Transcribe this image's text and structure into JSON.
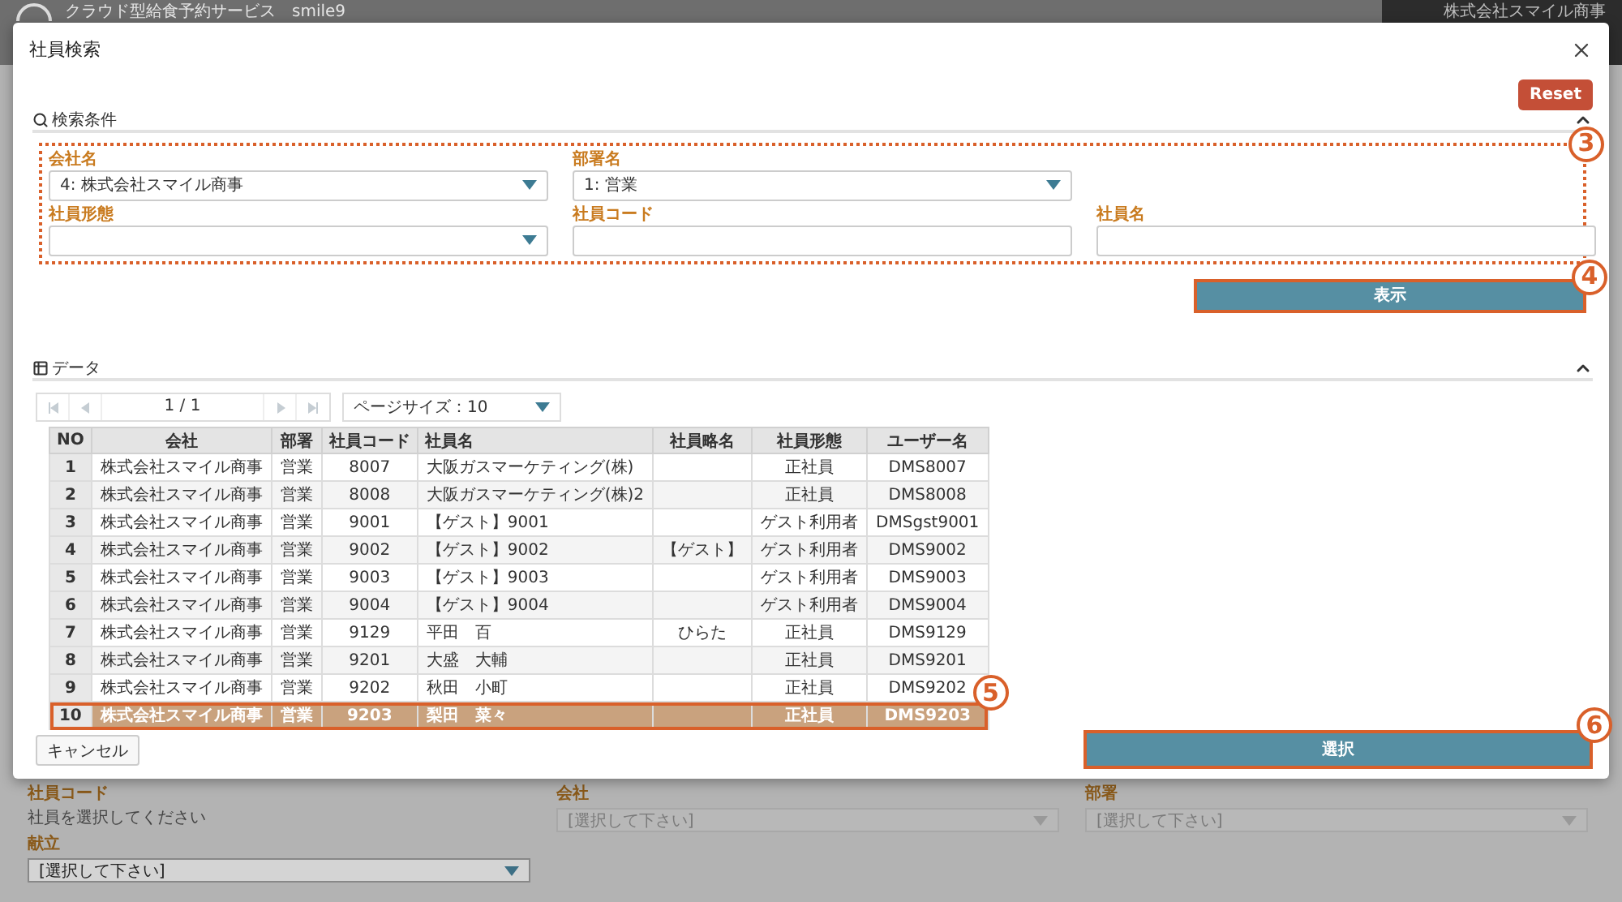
{
  "background": {
    "header_title": "クラウド型給食予約サービス　smile9",
    "header_user": "株式会社スマイル商事",
    "fields": [
      {
        "label": "社員コード",
        "kind": "text",
        "value": "社員を選択してください"
      },
      {
        "label": "会社",
        "kind": "select",
        "value": "[選択して下さい]",
        "disabled": true
      },
      {
        "label": "部署",
        "kind": "select",
        "value": "[選択して下さい]",
        "disabled": true
      },
      {
        "label": "献立",
        "kind": "select",
        "value": "[選択して下さい]",
        "disabled": false
      }
    ]
  },
  "dialog": {
    "title": "社員検索",
    "reset_button": "Reset",
    "search_section": {
      "title": "検索条件",
      "expanded": true,
      "callout": "3",
      "rows": [
        [
          {
            "label": "会社名",
            "kind": "select",
            "value": "4: 株式会社スマイル商事"
          },
          {
            "label": "部署名",
            "kind": "select",
            "value": "1: 営業"
          }
        ],
        [
          {
            "label": "社員形態",
            "kind": "select"
          },
          {
            "label": "社員コード",
            "kind": "text"
          },
          {
            "label": "社員名",
            "kind": "text"
          }
        ]
      ],
      "show_button": {
        "label": "表示",
        "callout": "4"
      }
    },
    "data_section": {
      "title": "データ",
      "expanded": true,
      "pager": {
        "page": "1 / 1",
        "page_size": "ページサイズ：10"
      },
      "table": {
        "callout": "5",
        "columns": [
          "NO",
          "会社",
          "部署",
          "社員コード",
          "社員名",
          "社員略名",
          "社員形態",
          "ユーザー名"
        ],
        "rows": [
          {
            "cells": [
              "1",
              "株式会社スマイル商事",
              "営業",
              "8007",
              "大阪ガスマーケティング(株)",
              "",
              "正社員",
              "DMS8007"
            ],
            "selected": false
          },
          {
            "cells": [
              "2",
              "株式会社スマイル商事",
              "営業",
              "8008",
              "大阪ガスマーケティング(株)2",
              "",
              "正社員",
              "DMS8008"
            ],
            "selected": false
          },
          {
            "cells": [
              "3",
              "株式会社スマイル商事",
              "営業",
              "9001",
              "【ゲスト】9001",
              "",
              "ゲスト利用者",
              "DMSgst9001"
            ],
            "selected": false
          },
          {
            "cells": [
              "4",
              "株式会社スマイル商事",
              "営業",
              "9002",
              "【ゲスト】9002",
              "【ゲスト】",
              "ゲスト利用者",
              "DMS9002"
            ],
            "selected": false
          },
          {
            "cells": [
              "5",
              "株式会社スマイル商事",
              "営業",
              "9003",
              "【ゲスト】9003",
              "",
              "ゲスト利用者",
              "DMS9003"
            ],
            "selected": false
          },
          {
            "cells": [
              "6",
              "株式会社スマイル商事",
              "営業",
              "9004",
              "【ゲスト】9004",
              "",
              "ゲスト利用者",
              "DMS9004"
            ],
            "selected": false
          },
          {
            "cells": [
              "7",
              "株式会社スマイル商事",
              "営業",
              "9129",
              "平田　百",
              "ひらた",
              "正社員",
              "DMS9129"
            ],
            "selected": false
          },
          {
            "cells": [
              "8",
              "株式会社スマイル商事",
              "営業",
              "9201",
              "大盛　大輔",
              "",
              "正社員",
              "DMS9201"
            ],
            "selected": false
          },
          {
            "cells": [
              "9",
              "株式会社スマイル商事",
              "営業",
              "9202",
              "秋田　小町",
              "",
              "正社員",
              "DMS9202"
            ],
            "selected": false
          },
          {
            "cells": [
              "10",
              "株式会社スマイル商事",
              "営業",
              "9203",
              "梨田　菜々",
              "",
              "正社員",
              "DMS9203"
            ],
            "selected": true
          }
        ]
      }
    },
    "cancel_button": "キャンセル",
    "select_button": {
      "label": "選択",
      "callout": "6"
    }
  }
}
